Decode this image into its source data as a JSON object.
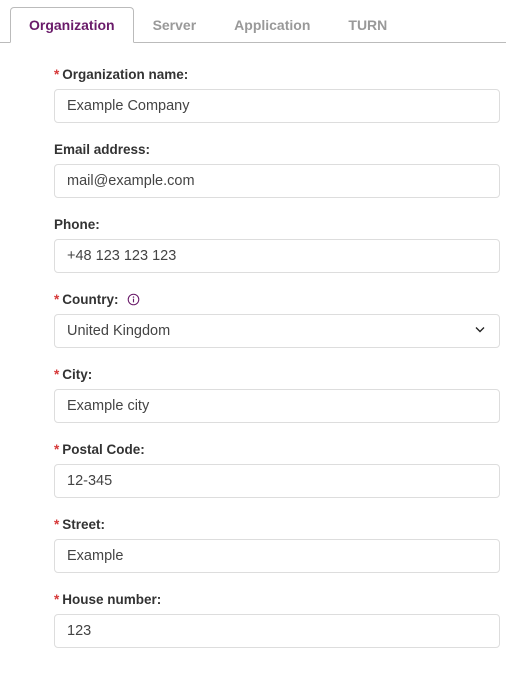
{
  "tabs": [
    {
      "label": "Organization",
      "active": true
    },
    {
      "label": "Server",
      "active": false
    },
    {
      "label": "Application",
      "active": false
    },
    {
      "label": "TURN",
      "active": false
    }
  ],
  "form": {
    "org_name": {
      "label": "Organization name:",
      "value": "Example Company",
      "required": true
    },
    "email": {
      "label": "Email address:",
      "value": "mail@example.com",
      "required": false
    },
    "phone": {
      "label": "Phone:",
      "value": "+48 123 123 123",
      "required": false
    },
    "country": {
      "label": "Country:",
      "value": "United Kingdom",
      "required": true,
      "info": true
    },
    "city": {
      "label": "City:",
      "value": "Example city",
      "required": true
    },
    "postal_code": {
      "label": "Postal Code:",
      "value": "12-345",
      "required": true
    },
    "street": {
      "label": "Street:",
      "value": "Example",
      "required": true
    },
    "house_number": {
      "label": "House number:",
      "value": "123",
      "required": true
    }
  }
}
